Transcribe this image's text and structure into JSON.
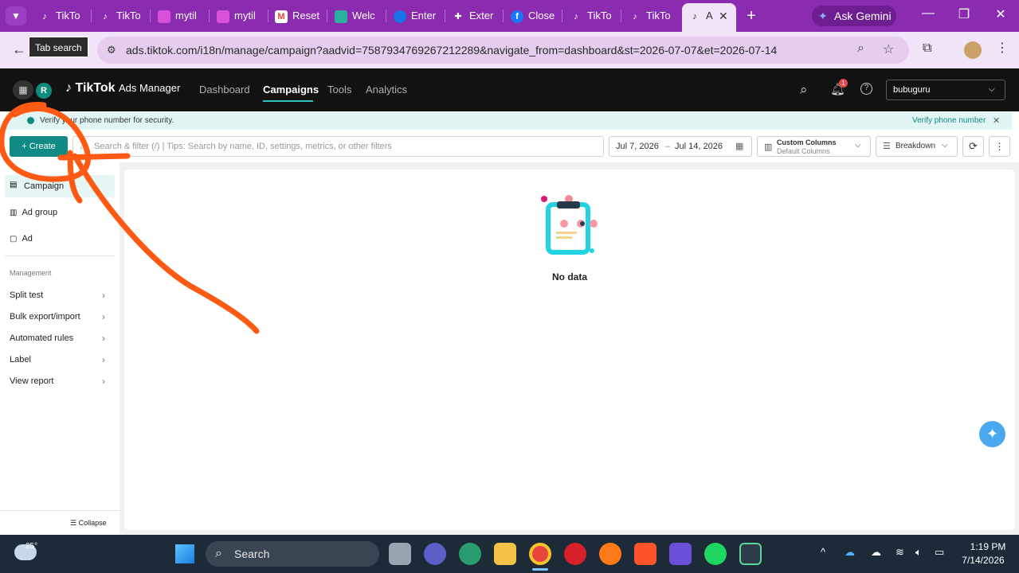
{
  "browser": {
    "tabs": [
      {
        "label": "TikTo",
        "icon": "tiktok-icon"
      },
      {
        "label": "TikTo",
        "icon": "tiktok-icon"
      },
      {
        "label": "mytil",
        "icon": "app-icon"
      },
      {
        "label": "mytil",
        "icon": "app-icon"
      },
      {
        "label": "Reset",
        "icon": "gmail-icon"
      },
      {
        "label": "Welc",
        "icon": "app-icon"
      },
      {
        "label": "Enter",
        "icon": "app-icon"
      },
      {
        "label": "Exter",
        "icon": "puzzle-icon"
      },
      {
        "label": "Close",
        "icon": "facebook-icon"
      },
      {
        "label": "TikTo",
        "icon": "tiktok-icon"
      },
      {
        "label": "TikTo",
        "icon": "tiktok-icon"
      },
      {
        "label": "A",
        "icon": "tiktok-icon"
      }
    ],
    "new_tab": "+",
    "gemini_label": "Ask Gemini",
    "tab_search_tooltip": "Tab search",
    "url": "ads.tiktok.com/i18n/manage/campaign?aadvid=7587934769267212289&navigate_from=dashboard&st=2026-07-07&et=2026-07-14",
    "colors": {
      "frame": "#8a2bb0",
      "toolbar": "#f2e4f8"
    }
  },
  "app": {
    "logo_text": "TikTok",
    "logo_sub": "Ads Manager",
    "avatar_letter": "R",
    "nav": [
      "Dashboard",
      "Campaigns",
      "Tools",
      "Analytics"
    ],
    "notification_count": "1",
    "account": "bubuguru",
    "banner_text": "Verify your phone number for security.",
    "banner_action": "Verify phone number",
    "create_label": "Create",
    "search_placeholder": "Search & filter (/) | Tips: Search by name, ID, settings, metrics, or other filters",
    "date_start": "Jul 7, 2026",
    "date_sep": "–",
    "date_end": "Jul 14, 2026",
    "columns_label": "Custom Columns",
    "columns_sub": "Default Columns",
    "breakdown_label": "Breakdown",
    "levels": [
      "Campaign",
      "Ad group",
      "Ad"
    ],
    "management_heading": "Management",
    "management_items": [
      "Split test",
      "Bulk export/import",
      "Automated rules",
      "Label",
      "View report"
    ],
    "collapse_label": "Collapse",
    "empty_text": "No data",
    "accent": "#108a84"
  },
  "taskbar": {
    "weather_temp": "25°",
    "search_label": "Search",
    "time": "1:19 PM",
    "date": "7/14/2026"
  }
}
